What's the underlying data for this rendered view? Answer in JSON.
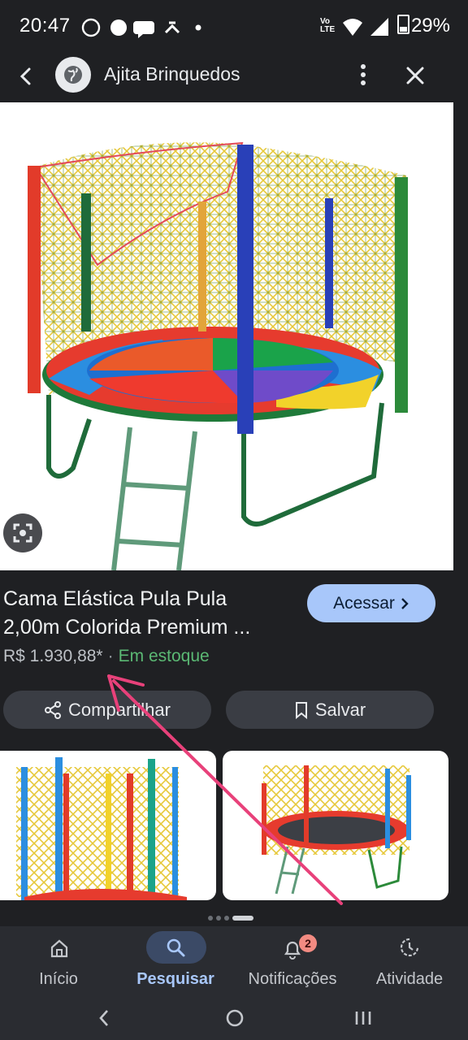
{
  "status_bar": {
    "time": "20:47",
    "network_label": "LTE",
    "battery": "29%"
  },
  "top_bar": {
    "site_name": "Ajita Brinquedos"
  },
  "product": {
    "title_line1": "Cama Elástica Pula Pula",
    "title_line2": "2,00m Colorida Premium ...",
    "price": "R$ 1.930,88*",
    "separator": "·",
    "stock": "Em estoque",
    "visit_label": "Acessar",
    "share_label": "Compartilhar",
    "save_label": "Salvar"
  },
  "bottom_nav": {
    "items": [
      {
        "label": "Início",
        "icon": "home-icon"
      },
      {
        "label": "Pesquisar",
        "icon": "search-icon"
      },
      {
        "label": "Notificações",
        "icon": "bell-icon",
        "badge": "2"
      },
      {
        "label": "Atividade",
        "icon": "activity-icon"
      }
    ],
    "active_index": 1
  },
  "colors": {
    "accent": "#a8c7fa",
    "stock_green": "#5bb974",
    "annotation_arrow": "#e8417a"
  }
}
